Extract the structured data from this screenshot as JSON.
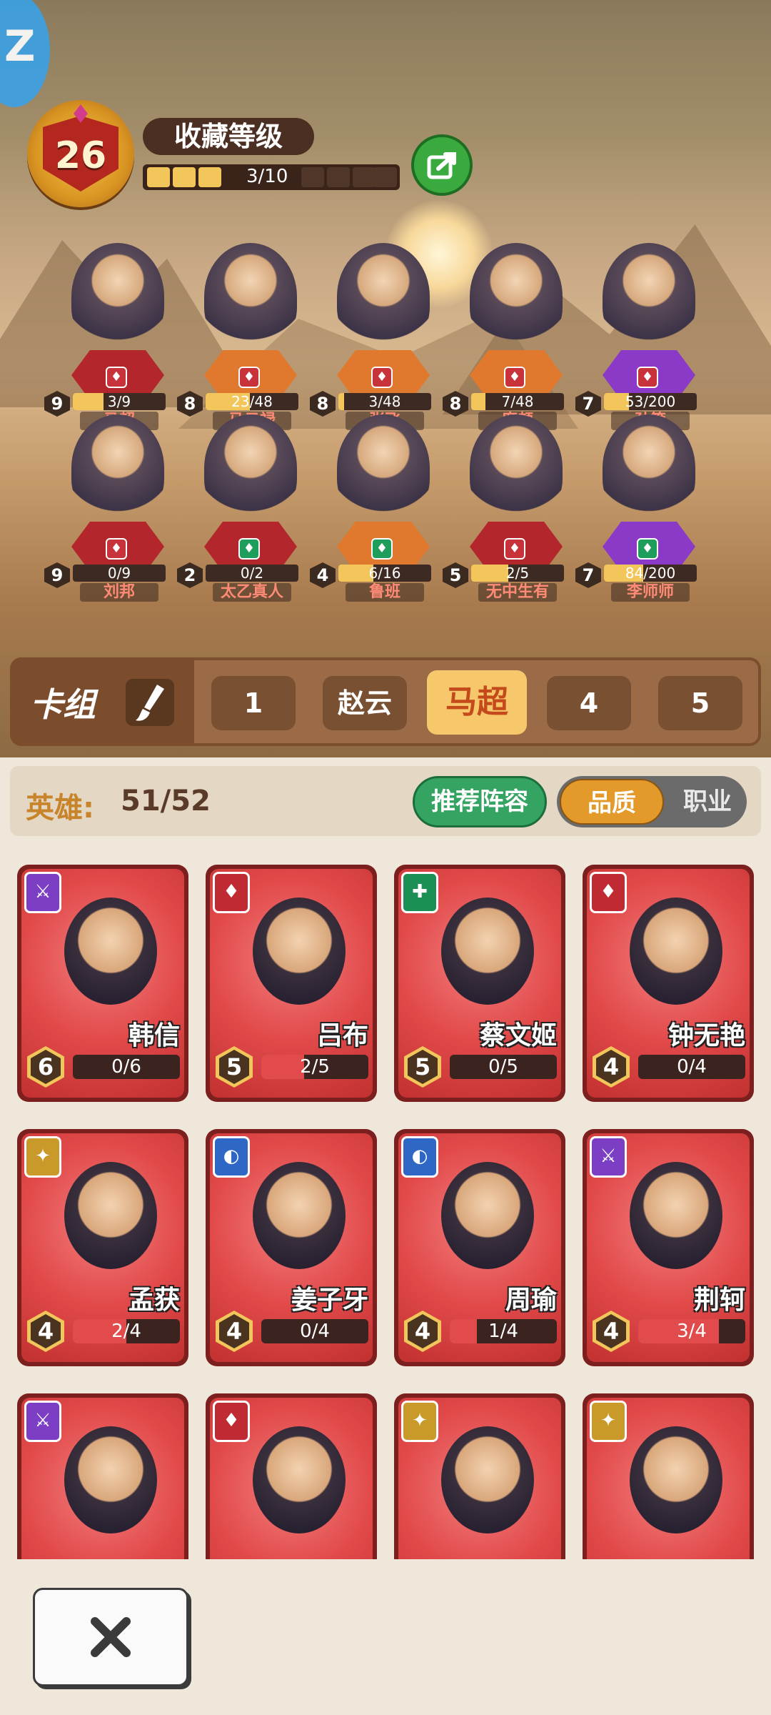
{
  "collection": {
    "level": "26",
    "title": "收藏等级",
    "progress_text": "3/10",
    "progress_value": 0.3
  },
  "featured_heroes": [
    {
      "name": "马超",
      "level": "9",
      "progress": "3/9",
      "fraction": 0.33
    },
    {
      "name": "马云禄",
      "level": "8",
      "progress": "23/48",
      "fraction": 0.48
    },
    {
      "name": "张飞",
      "level": "8",
      "progress": "3/48",
      "fraction": 0.06
    },
    {
      "name": "廉颇",
      "level": "8",
      "progress": "7/48",
      "fraction": 0.15
    },
    {
      "name": "孙策",
      "level": "7",
      "progress": "53/200",
      "fraction": 0.27
    },
    {
      "name": "刘邦",
      "level": "9",
      "progress": "0/9",
      "fraction": 0.0
    },
    {
      "name": "太乙真人",
      "level": "2",
      "progress": "0/2",
      "fraction": 0.0
    },
    {
      "name": "鲁班",
      "level": "4",
      "progress": "6/16",
      "fraction": 0.38
    },
    {
      "name": "无中生有",
      "level": "5",
      "progress": "2/5",
      "fraction": 0.4
    },
    {
      "name": "李师师",
      "level": "7",
      "progress": "84/200",
      "fraction": 0.42
    }
  ],
  "deck": {
    "label": "卡组",
    "tabs": [
      "1",
      "赵云",
      "马超",
      "4",
      "5"
    ],
    "active_index": 2
  },
  "heroes_header": {
    "label": "英雄:",
    "count": "51/52",
    "recommend_label": "推荐阵容",
    "toggle": {
      "quality": "品质",
      "class": "职业",
      "selected": "品质"
    }
  },
  "cards": [
    {
      "name": "韩信",
      "level": "6",
      "progress": "0/6",
      "fraction": 0.0,
      "class_color": "purple"
    },
    {
      "name": "吕布",
      "level": "5",
      "progress": "2/5",
      "fraction": 0.4,
      "class_color": "red"
    },
    {
      "name": "蔡文姬",
      "level": "5",
      "progress": "0/5",
      "fraction": 0.0,
      "class_color": "green"
    },
    {
      "name": "钟无艳",
      "level": "4",
      "progress": "0/4",
      "fraction": 0.0,
      "class_color": "red"
    },
    {
      "name": "孟获",
      "level": "4",
      "progress": "2/4",
      "fraction": 0.5,
      "class_color": "gold"
    },
    {
      "name": "姜子牙",
      "level": "4",
      "progress": "0/4",
      "fraction": 0.0,
      "class_color": "blue"
    },
    {
      "name": "周瑜",
      "level": "4",
      "progress": "1/4",
      "fraction": 0.25,
      "class_color": "blue"
    },
    {
      "name": "荆轲",
      "level": "4",
      "progress": "3/4",
      "fraction": 0.75,
      "class_color": "purple"
    },
    {
      "name": "",
      "level": "",
      "progress": "",
      "fraction": 0.0,
      "class_color": "purple"
    },
    {
      "name": "",
      "level": "",
      "progress": "",
      "fraction": 0.0,
      "class_color": "red"
    },
    {
      "name": "",
      "level": "",
      "progress": "",
      "fraction": 0.0,
      "class_color": "gold"
    },
    {
      "name": "",
      "level": "",
      "progress": "",
      "fraction": 0.0,
      "class_color": "gold"
    }
  ],
  "icons": {
    "share": "share-arrow-icon",
    "edit": "brush-icon",
    "close": "close-x-icon"
  },
  "colors": {
    "accent_gold": "#f2c65a",
    "accent_green": "#35a362",
    "card_red": "#e24a4a"
  }
}
